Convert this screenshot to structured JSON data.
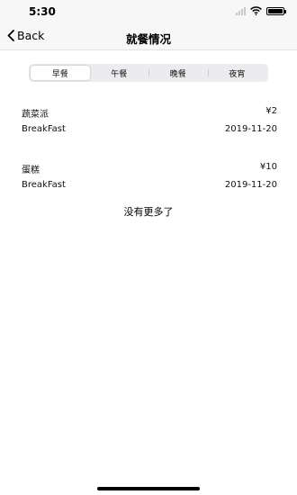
{
  "status_bar": {
    "time": "5:30"
  },
  "nav": {
    "back_label": "Back",
    "title": "就餐情况"
  },
  "tabs": [
    {
      "label": "早餐",
      "active": true
    },
    {
      "label": "午餐",
      "active": false
    },
    {
      "label": "晚餐",
      "active": false
    },
    {
      "label": "夜宵",
      "active": false
    }
  ],
  "meals": [
    {
      "name": "蔬菜派",
      "price": "¥2",
      "type": "BreakFast",
      "date": "2019-11-20"
    },
    {
      "name": "蛋糕",
      "price": "¥10",
      "type": "BreakFast",
      "date": "2019-11-20"
    }
  ],
  "footer_text": "没有更多了",
  "colors": {
    "background": "#ffffff",
    "bar": "#f7f7f7",
    "segment_bg": "#ececef"
  }
}
